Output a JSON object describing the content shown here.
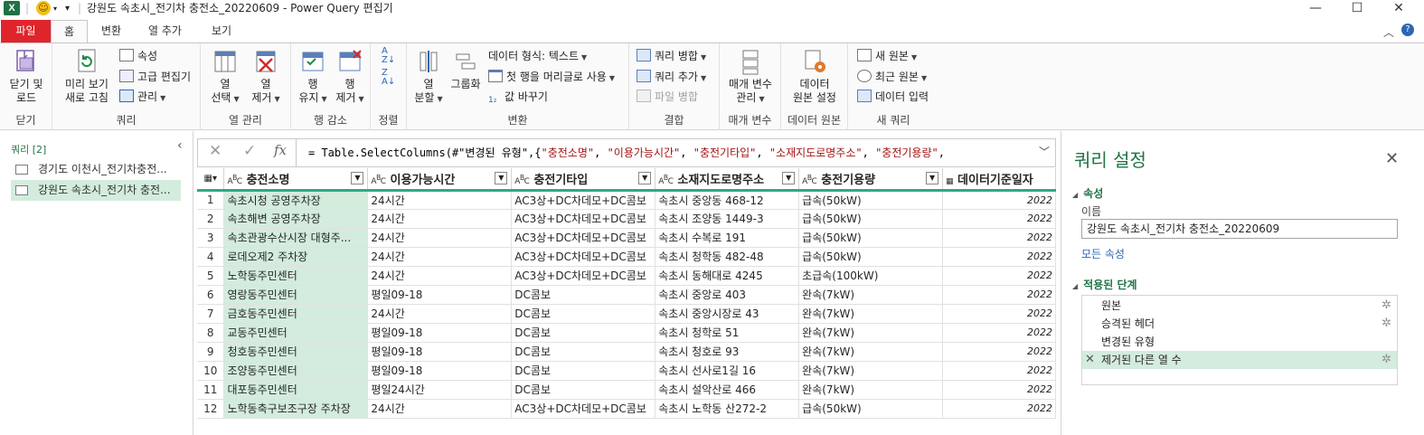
{
  "title_bar": {
    "title": "강원도 속초시_전기차 충전소_20220609 - Power Query 편집기",
    "minimize": "—",
    "maximize": "☐",
    "close": "✕"
  },
  "ribbon_tabs": [
    "파일",
    "홈",
    "변환",
    "열 추가",
    "보기"
  ],
  "ribbon": {
    "close": {
      "btn": "닫기 및\n로드",
      "group": "닫기"
    },
    "query": {
      "refresh": "미리 보기\n새로 고침",
      "properties": "속성",
      "advanced_editor": "고급 편집기",
      "manage": "관리",
      "group": "쿼리"
    },
    "cols": {
      "select": "열\n선택",
      "remove": "열\n제거",
      "group": "열 관리"
    },
    "rows": {
      "keep": "행\n유지",
      "remove": "행\n제거",
      "group": "행 감소"
    },
    "sort": {
      "group": "정렬"
    },
    "transform": {
      "split": "열\n분할",
      "group_by": "그룹화",
      "data_type": "데이터 형식: 텍스트",
      "first_row_header": "첫 행을 머리글로 사용",
      "replace_values": "값 바꾸기",
      "group": "변환"
    },
    "combine": {
      "merge": "쿼리 병합",
      "append": "쿼리 추가",
      "combine_files": "파일 병합",
      "group": "결합"
    },
    "params": {
      "btn": "매개 변수\n관리",
      "group": "매개 변수"
    },
    "source": {
      "btn": "데이터\n원본 설정",
      "group": "데이터 원본"
    },
    "new_query": {
      "new_source": "새 원본",
      "recent": "최근 원본",
      "enter_data": "데이터 입력",
      "group": "새 쿼리"
    }
  },
  "queries_pane": {
    "header": "쿼리 [2]",
    "items": [
      "경기도 이천시_전기차충전...",
      "강원도 속초시_전기차 충전..."
    ]
  },
  "formula_bar": {
    "prefix": "= Table.SelectColumns(#\"변경된 유형\",{",
    "items": [
      "\"충전소명\"",
      "\"이용가능시간\"",
      "\"충전기타입\"",
      "\"소재지도로명주소\"",
      "\"충전기용량\""
    ],
    "fx": "fx"
  },
  "table": {
    "columns": [
      "충전소명",
      "이용가능시간",
      "충전기타입",
      "소재지도로명주소",
      "충전기용량",
      "데이터기준일자"
    ],
    "rows": [
      [
        "1",
        "속초시청 공영주차장",
        "24시간",
        "AC3상+DC차데모+DC콤보",
        "속초시 중앙동 468-12",
        "급속(50kW)",
        "2022"
      ],
      [
        "2",
        "속초해변 공영주차장",
        "24시간",
        "AC3상+DC차데모+DC콤보",
        "속초시 조양동 1449-3",
        "급속(50kW)",
        "2022"
      ],
      [
        "3",
        "속초관광수산시장 대형주...",
        "24시간",
        "AC3상+DC차데모+DC콤보",
        "속초시 수복로 191",
        "급속(50kW)",
        "2022"
      ],
      [
        "4",
        "로데오제2 주차장",
        "24시간",
        "AC3상+DC차데모+DC콤보",
        "속초시 청학동 482-48",
        "급속(50kW)",
        "2022"
      ],
      [
        "5",
        "노학동주민센터",
        "24시간",
        "AC3상+DC차데모+DC콤보",
        "속초시 동해대로 4245",
        "초급속(100kW)",
        "2022"
      ],
      [
        "6",
        "영랑동주민센터",
        "평일09-18",
        "DC콤보",
        "속초시 중앙로 403",
        "완속(7kW)",
        "2022"
      ],
      [
        "7",
        "금호동주민센터",
        "24시간",
        "DC콤보",
        "속초시 중앙시장로 43",
        "완속(7kW)",
        "2022"
      ],
      [
        "8",
        "교동주민센터",
        "평일09-18",
        "DC콤보",
        "속초시 청학로 51",
        "완속(7kW)",
        "2022"
      ],
      [
        "9",
        "청호동주민센터",
        "평일09-18",
        "DC콤보",
        "속초시 청호로 93",
        "완속(7kW)",
        "2022"
      ],
      [
        "10",
        "조양동주민센터",
        "평일09-18",
        "DC콤보",
        "속초시 선사로1길 16",
        "완속(7kW)",
        "2022"
      ],
      [
        "11",
        "대포동주민센터",
        "평일24시간",
        "DC콤보",
        "속초시 설악산로 466",
        "완속(7kW)",
        "2022"
      ],
      [
        "12",
        "노학동축구보조구장 주차장",
        "24시간",
        "AC3상+DC차데모+DC콤보",
        "속초시 노학동 산272-2",
        "급속(50kW)",
        "2022"
      ]
    ]
  },
  "settings_pane": {
    "title": "쿼리 설정",
    "properties_header": "속성",
    "name_label": "이름",
    "name_value": "강원도 속초시_전기차 충전소_20220609",
    "all_properties": "모든 속성",
    "steps_header": "적용된 단계",
    "steps": [
      "원본",
      "승격된 헤더",
      "변경된 유형",
      "제거된 다른 열 수"
    ]
  }
}
